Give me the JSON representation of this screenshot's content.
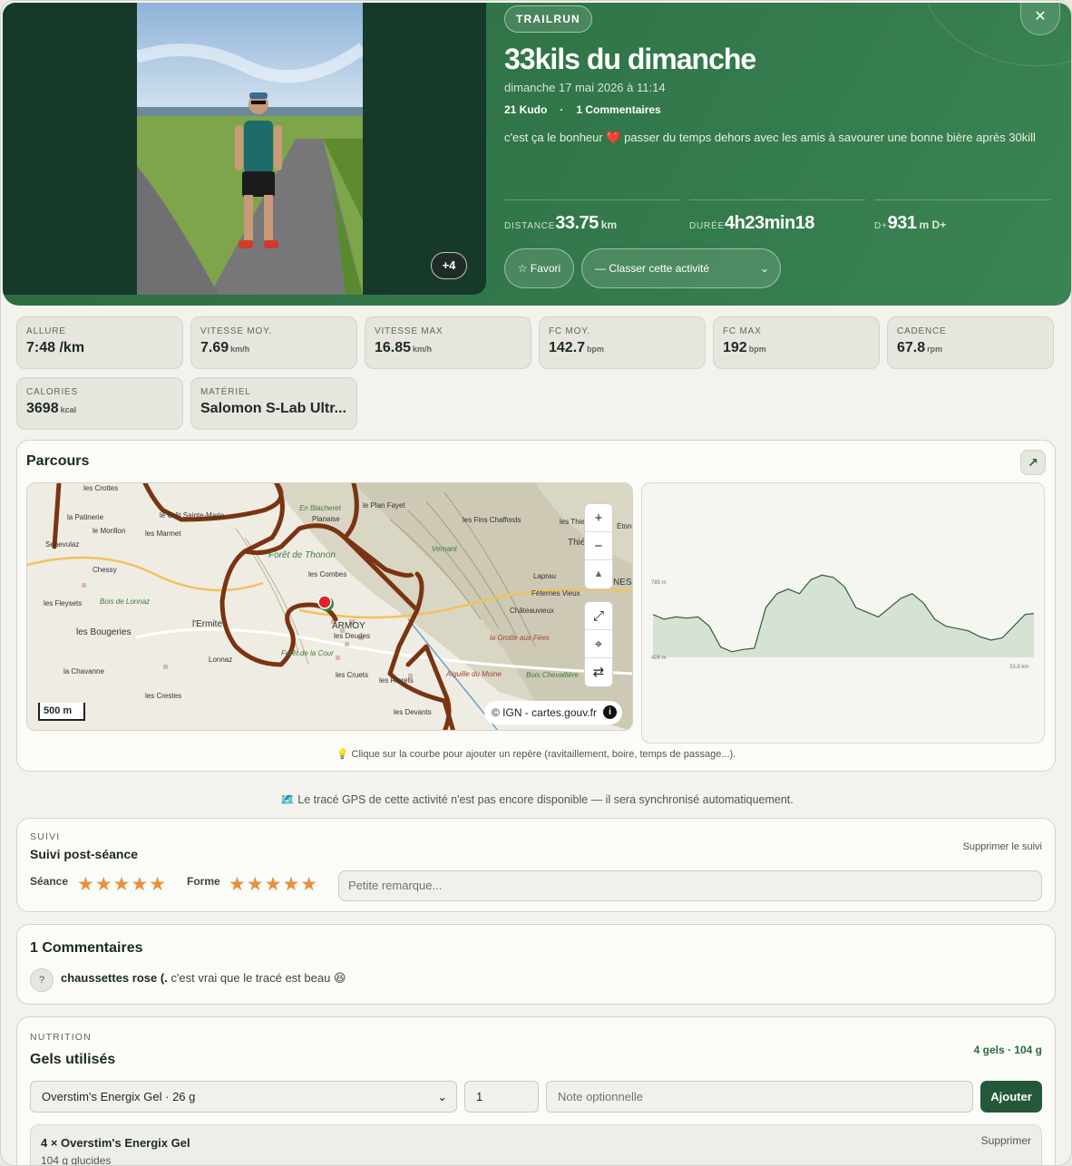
{
  "hero": {
    "sport_badge": "TRAILRUN",
    "title": "33kils du dimanche",
    "date": "dimanche 17 mai 2026 à 11:14",
    "kudos": "21 Kudo",
    "separator": "·",
    "comments_count": "1 Commentaires",
    "description": "c'est ça le bonheur ❤️ passer du temps dehors avec les amis à savourer une bonne bière après 30kill",
    "photo_more": "+4",
    "close": "✕",
    "stats": [
      {
        "label": "DISTANCE",
        "value": "33.75",
        "unit": "km"
      },
      {
        "label": "DURÉE",
        "value": "4h23min18",
        "unit": ""
      },
      {
        "label": "D+",
        "value": "931",
        "unit": "m D+"
      }
    ],
    "favorite_label": "☆ Favori",
    "classify_label": "— Classer cette activité",
    "classify_chevron": "⌄"
  },
  "metrics": [
    {
      "label": "ALLURE",
      "value": "7:48 /km",
      "unit": ""
    },
    {
      "label": "VITESSE MOY.",
      "value": "7.69",
      "unit": "km/h"
    },
    {
      "label": "VITESSE MAX",
      "value": "16.85",
      "unit": "km/h"
    },
    {
      "label": "FC MOY.",
      "value": "142.7",
      "unit": "bpm"
    },
    {
      "label": "FC MAX",
      "value": "192",
      "unit": "bpm"
    },
    {
      "label": "CADENCE",
      "value": "67.8",
      "unit": "rpm"
    },
    {
      "label": "CALORIES",
      "value": "3698",
      "unit": "kcal"
    },
    {
      "label": "MATÉRIEL",
      "value": "Salomon S-Lab Ultr...",
      "unit": ""
    }
  ],
  "parcours": {
    "title": "Parcours",
    "open_icon": "↗",
    "map": {
      "zoom_in": "+",
      "zoom_out": "−",
      "compass": "▲",
      "fullscreen": "⤢",
      "locate": "⌖",
      "swap": "⇄",
      "scale": "500 m",
      "attribution": "© IGN - cartes.gouv.fr",
      "info": "i",
      "place_names": [
        "les Crottes",
        "la Patinerie",
        "le Crêt Sainte-Marie",
        "le Morillon",
        "Senevulaz",
        "Chessy",
        "les Fleysets",
        "Bois de Lonnaz",
        "les Bougeries",
        "l'Ermite",
        "la Chavanne",
        "les Crestes",
        "Lonnaz",
        "En Blacheret",
        "Planaise",
        "les Marmet",
        "Forêt de Thonon",
        "les Combes",
        "ARMOY",
        "les Deudes",
        "les Cruets",
        "les Rierets",
        "les Devants",
        "le Plan Fayet",
        "les Fins Chaffords",
        "Vernant",
        "Laprau",
        "Féternes Vieux",
        "Châteauvieux",
        "la Grotte aux Fées",
        "Bois Chevallière",
        "Aiguille du Moine",
        "Thié",
        "NES",
        "Étong",
        "les Thie",
        "Forêt de la Cour"
      ]
    },
    "profile": {
      "y_top_label": "785 m",
      "y_bottom_label": "426 m",
      "x_end_label": "33.8 km"
    },
    "hint": "💡 Clique sur la courbe pour ajouter un repère (ravitaillement, boire, temps de passage...)."
  },
  "chart_data": {
    "type": "area",
    "title": "",
    "xlabel": "",
    "ylabel": "",
    "xlim": [
      0,
      33.8
    ],
    "ylim": [
      426,
      785
    ],
    "x": [
      0,
      1,
      2,
      3,
      4,
      5,
      6,
      7,
      8,
      9,
      10,
      11,
      12,
      13,
      14,
      15,
      16,
      17,
      18,
      19,
      20,
      21,
      22,
      23,
      24,
      25,
      26,
      27,
      28,
      29,
      30,
      31,
      32,
      33,
      33.8
    ],
    "series": [
      {
        "values": [
          610,
          590,
          600,
          595,
          600,
          560,
          470,
          450,
          460,
          465,
          640,
          700,
          720,
          700,
          760,
          780,
          770,
          730,
          640,
          620,
          600,
          640,
          680,
          700,
          660,
          590,
          560,
          550,
          540,
          515,
          500,
          510,
          560,
          610,
          615
        ]
      }
    ]
  },
  "gps_note": "🗺️ Le tracé GPS de cette activité n'est pas encore disponible — il sera synchronisé automatiquement.",
  "suivi": {
    "section_label": "SUIVI",
    "title": "Suivi post-séance",
    "delete_label": "Supprimer le suivi",
    "seance_label": "Séance",
    "seance_rating": 5,
    "forme_label": "Forme",
    "forme_rating": 5,
    "stars_seance": "★★★★★",
    "stars_forme": "★★★★★",
    "remark_placeholder": "Petite remarque..."
  },
  "comments": {
    "title": "1 Commentaires",
    "items": [
      {
        "avatar": "?",
        "author": "chaussettes rose (.",
        "text": "c'est vrai que le tracé est beau 😆"
      }
    ]
  },
  "nutrition": {
    "section_label": "NUTRITION",
    "title": "Gels utilisés",
    "summary": "4 gels · 104 g",
    "gel_select": "Overstim's Energix Gel · 26 g",
    "select_chevron": "⌄",
    "quantity": "1",
    "note_placeholder": "Note optionnelle",
    "add_label": "Ajouter",
    "items": [
      {
        "name": "4 × Overstim's Energix Gel",
        "detail": "104 g glucides",
        "delete_label": "Supprimer"
      }
    ]
  },
  "colors": {
    "hero_green": "#33794b",
    "accent_button": "#24583a",
    "star": "#e8903a",
    "route": "#7a3412"
  }
}
